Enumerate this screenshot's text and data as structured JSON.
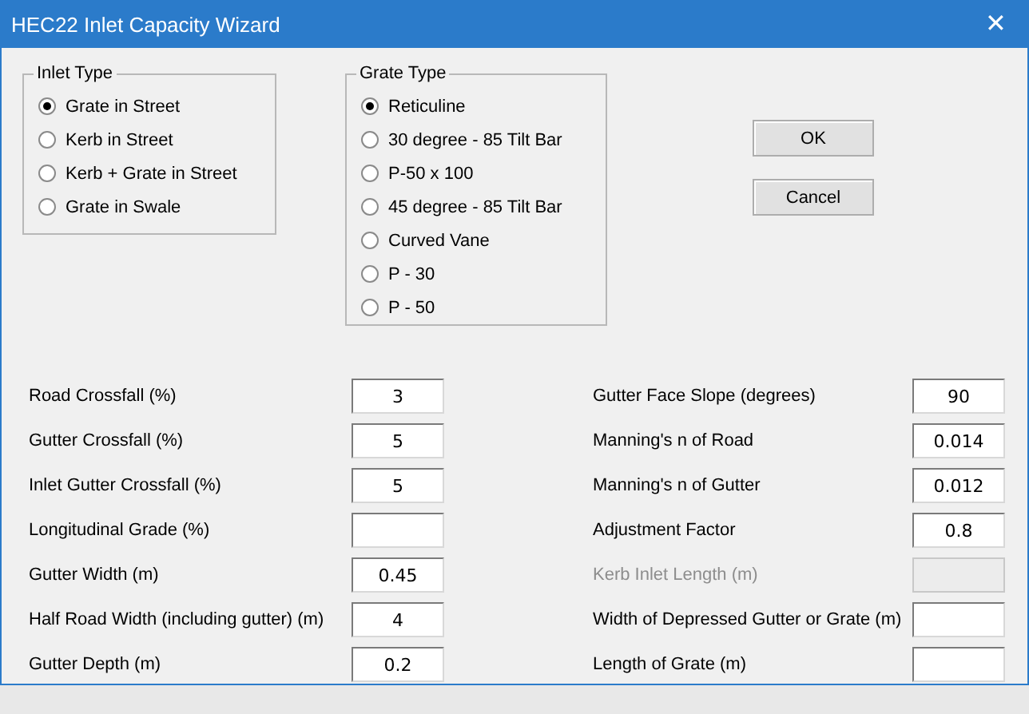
{
  "window": {
    "title": "HEC22 Inlet Capacity Wizard",
    "close": "✕"
  },
  "inlet_type": {
    "title": "Inlet Type",
    "options": [
      {
        "label": "Grate in Street",
        "selected": true
      },
      {
        "label": "Kerb in Street",
        "selected": false
      },
      {
        "label": "Kerb + Grate in Street",
        "selected": false
      },
      {
        "label": "Grate in Swale",
        "selected": false
      }
    ]
  },
  "grate_type": {
    "title": "Grate Type",
    "options": [
      {
        "label": "Reticuline",
        "selected": true
      },
      {
        "label": "30 degree - 85 Tilt Bar",
        "selected": false
      },
      {
        "label": "P-50 x 100",
        "selected": false
      },
      {
        "label": "45 degree - 85 Tilt Bar",
        "selected": false
      },
      {
        "label": "Curved Vane",
        "selected": false
      },
      {
        "label": "P - 30",
        "selected": false
      },
      {
        "label": "P - 50",
        "selected": false
      }
    ]
  },
  "buttons": [
    "OK",
    "Cancel"
  ],
  "left_fields": [
    {
      "label": "Road Crossfall (%)",
      "value": "3",
      "disabled": false
    },
    {
      "label": "Gutter Crossfall (%)",
      "value": "5",
      "disabled": false
    },
    {
      "label": "Inlet Gutter Crossfall (%)",
      "value": "5",
      "disabled": false
    },
    {
      "label": "Longitudinal Grade (%)",
      "disabled": false
    },
    {
      "label": "Gutter Width (m)",
      "value": "0.45",
      "disabled": false
    },
    {
      "label": "Half Road Width (including gutter) (m)",
      "value": "4",
      "disabled": false
    },
    {
      "label": "Gutter Depth (m)",
      "value": "0.2",
      "disabled": false
    }
  ],
  "right_fields": [
    {
      "label": "Gutter Face Slope (degrees)",
      "value": "90",
      "disabled": false
    },
    {
      "label": "Manning's n of Road",
      "value": "0.014",
      "disabled": false
    },
    {
      "label": "Manning's n of Gutter",
      "value": "0.012",
      "disabled": false
    },
    {
      "label": "Adjustment Factor",
      "value": "0.8",
      "disabled": false
    },
    {
      "label": "Kerb Inlet Length (m)",
      "disabled": true
    },
    {
      "label": "Width of Depressed Gutter or Grate (m)",
      "disabled": false
    },
    {
      "label": "Length of Grate (m)",
      "disabled": false
    }
  ]
}
